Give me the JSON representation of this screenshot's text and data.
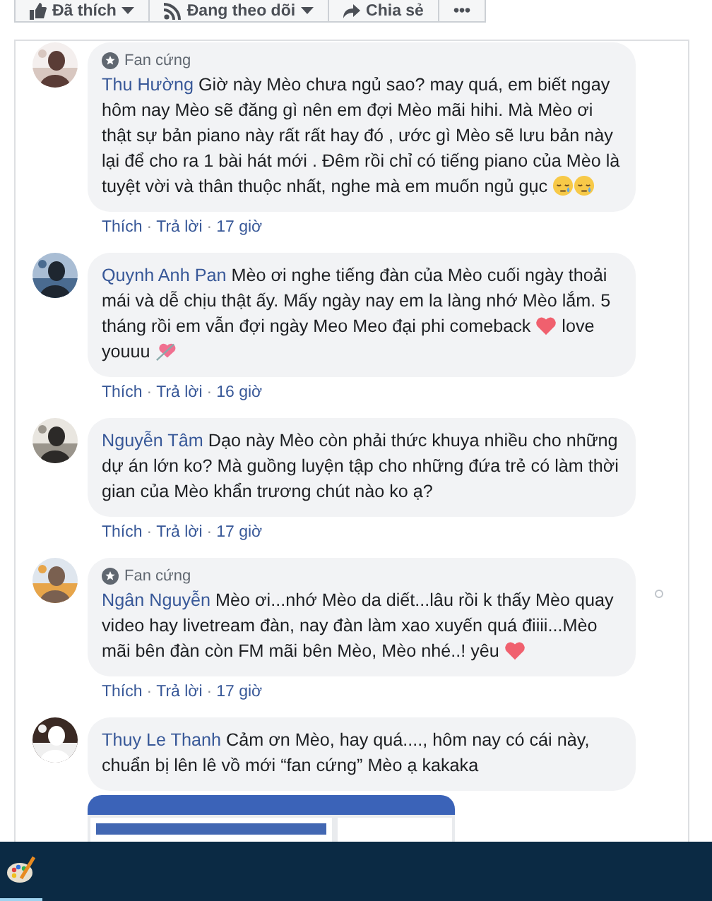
{
  "top_actions": [
    {
      "kind": "like",
      "label": "Đã thích",
      "dropdown": true
    },
    {
      "kind": "follow",
      "label": "Đang theo dõi",
      "dropdown": true
    },
    {
      "kind": "share",
      "label": "Chia sẻ",
      "dropdown": false
    },
    {
      "kind": "more",
      "label": "•••",
      "dropdown": false
    }
  ],
  "separator": "·",
  "comments": [
    {
      "badge": "Fan cứng",
      "author": "Thu Hường",
      "options": false,
      "parts": [
        {
          "kind": "text",
          "text": "Giờ này Mèo chưa ngủ sao? may quá, em biết ngay hôm nay Mèo sẽ đăng gì nên em đợi Mèo mãi hihi. Mà Mèo ơi thật sự bản piano này rất rất hay đó , ước gì Mèo sẽ lưu bản này lại để cho ra 1 bài hát mới . Đêm rồi chỉ có tiếng piano của Mèo là tuyệt vời và thân thuộc nhất, nghe mà em muốn ngủ gục "
        },
        {
          "kind": "sleepy"
        },
        {
          "kind": "sleepy"
        }
      ],
      "meta": [
        "Thích",
        "Trả lời",
        "17 giờ"
      ],
      "attachment": false
    },
    {
      "author": "Quynh Anh Pan",
      "options": false,
      "parts": [
        {
          "kind": "text",
          "text": "Mèo ơi nghe tiếng đàn của Mèo cuối ngày thoải mái và dễ chịu thật ấy. Mấy ngày nay em la làng nhớ Mèo lắm. 5 tháng rồi em vẫn đợi ngày Meo Meo đại phi comeback "
        },
        {
          "kind": "heart"
        },
        {
          "kind": "text",
          "text": " love youuu "
        },
        {
          "kind": "arrow-heart"
        }
      ],
      "meta": [
        "Thích",
        "Trả lời",
        "16 giờ"
      ],
      "attachment": false
    },
    {
      "author": "Nguyễn Tâm",
      "options": false,
      "parts": [
        {
          "kind": "text",
          "text": "Dạo này Mèo còn phải thức khuya nhiều cho những dự án lớn ko? Mà guồng luyện tập cho những đứa trẻ có làm thời gian của Mèo khẩn trương chút nào ko ạ?"
        }
      ],
      "meta": [
        "Thích",
        "Trả lời",
        "17 giờ"
      ],
      "attachment": false
    },
    {
      "badge": "Fan cứng",
      "author": "Ngân Nguyễn",
      "options": true,
      "parts": [
        {
          "kind": "text",
          "text": "Mèo ơi...nhớ Mèo da diết...lâu rồi k thấy Mèo quay video hay livetream đàn, nay đàn làm xao xuyến quá điiii...Mèo mãi bên đàn còn FM mãi bên Mèo, Mèo nhé..! yêu "
        },
        {
          "kind": "heart"
        }
      ],
      "meta": [
        "Thích",
        "Trả lời",
        "17 giờ"
      ],
      "attachment": false
    },
    {
      "author": "Thuy Le Thanh",
      "options": false,
      "parts": [
        {
          "kind": "text",
          "text": "Cảm ơn Mèo, hay quá...., hôm nay có cái này, chuẩn bị lên lê vồ mới “fan cứng” Mèo ạ kakaka"
        }
      ],
      "attachment": true
    }
  ]
}
